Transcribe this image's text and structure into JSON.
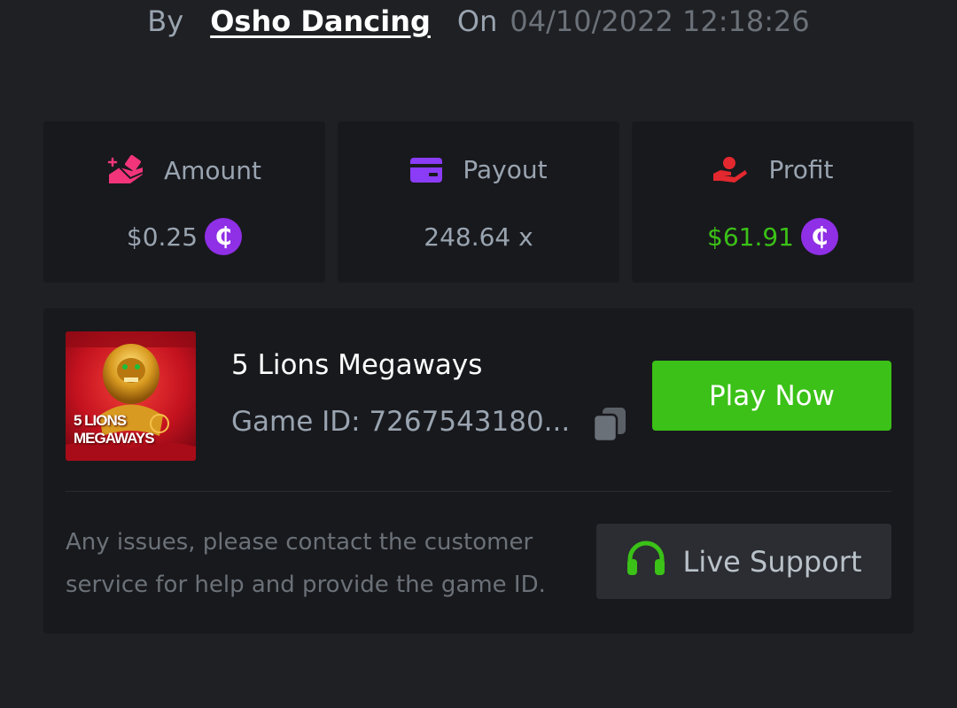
{
  "header": {
    "by_label": "By",
    "user_name": "Osho Dancing",
    "on_label": "On",
    "timestamp": "04/10/2022 12:18:26"
  },
  "stats": {
    "amount": {
      "label": "Amount",
      "value": "$0.25",
      "icon": "bet-chips-icon",
      "icon_color": "#f2357b"
    },
    "payout": {
      "label": "Payout",
      "value": "248.64 x",
      "icon": "card-icon",
      "icon_color": "#8b3cf6"
    },
    "profit": {
      "label": "Profit",
      "value": "$61.91",
      "icon": "hand-coin-icon",
      "icon_color": "#e4282f",
      "value_color": "#3bc117"
    },
    "currency_symbol": "₵",
    "currency_color": "#8f2fe6"
  },
  "game": {
    "title": "5 Lions Megaways",
    "thumbnail_text_line1": "5 LIONS",
    "thumbnail_text_line2": "MEGAWAYS",
    "game_id": "Game ID: 7267543180...",
    "play_label": "Play Now",
    "play_color": "#3bc117"
  },
  "support": {
    "help_text": "Any issues, please contact the customer service for help and provide the game ID.",
    "button_label": "Live Support",
    "icon": "headset-icon",
    "icon_color": "#3bc117"
  }
}
